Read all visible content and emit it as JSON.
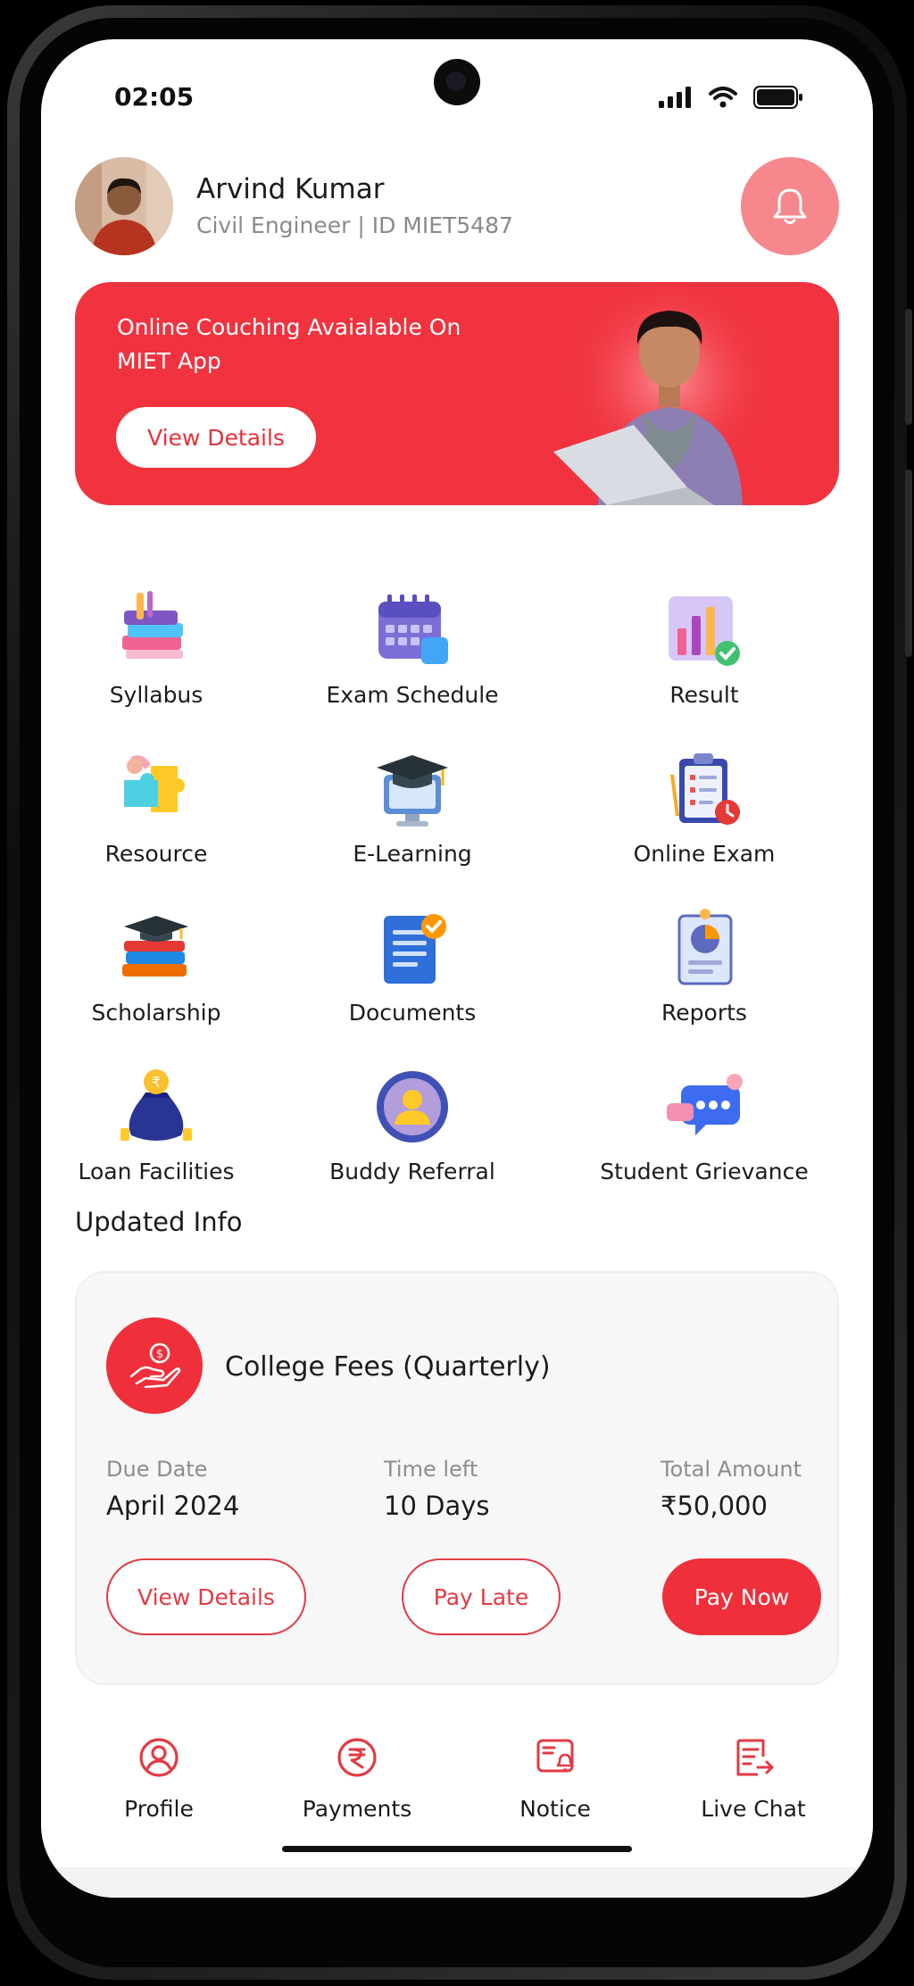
{
  "status_bar": {
    "time": "02:05"
  },
  "user": {
    "name": "Arvind Kumar",
    "subtitle": "Civil Engineer | ID MIET5487"
  },
  "banner": {
    "text": "Online Couching Avaialable On MIET App",
    "button_label": "View Details"
  },
  "services": [
    {
      "label": "Syllabus",
      "icon": "books-icon"
    },
    {
      "label": "Exam Schedule",
      "icon": "calendar-icon"
    },
    {
      "label": "Result",
      "icon": "bar-chart-icon"
    },
    {
      "label": "Resource",
      "icon": "puzzle-icon"
    },
    {
      "label": "E-Learning",
      "icon": "graduation-monitor-icon"
    },
    {
      "label": "Online Exam",
      "icon": "clipboard-clock-icon"
    },
    {
      "label": "Scholarship",
      "icon": "cap-books-icon"
    },
    {
      "label": "Documents",
      "icon": "document-check-icon"
    },
    {
      "label": "Reports",
      "icon": "report-pie-icon"
    },
    {
      "label": "Loan Facilities",
      "icon": "money-bag-icon"
    },
    {
      "label": "Buddy Referral",
      "icon": "user-circle-icon"
    },
    {
      "label": "Student Grievance",
      "icon": "chat-bubbles-icon"
    }
  ],
  "updated_info": {
    "title": "Updated Info",
    "fee": {
      "title": "College Fees (Quarterly)",
      "due_date_label": "Due Date",
      "due_date": "April 2024",
      "time_left_label": "Time left",
      "time_left": "10 Days",
      "total_label": "Total Amount",
      "total": "₹50,000",
      "view_details_label": "View Details",
      "pay_late_label": "Pay Late",
      "pay_now_label": "Pay Now"
    }
  },
  "bottom_nav": [
    {
      "label": "Profile",
      "icon": "profile-icon"
    },
    {
      "label": "Payments",
      "icon": "rupee-icon"
    },
    {
      "label": "Notice",
      "icon": "notice-icon"
    },
    {
      "label": "Live Chat",
      "icon": "live-chat-icon"
    }
  ],
  "colors": {
    "accent": "#ef2f3a",
    "bell_bg": "#f6878c",
    "card_bg": "#f7f7f7"
  }
}
